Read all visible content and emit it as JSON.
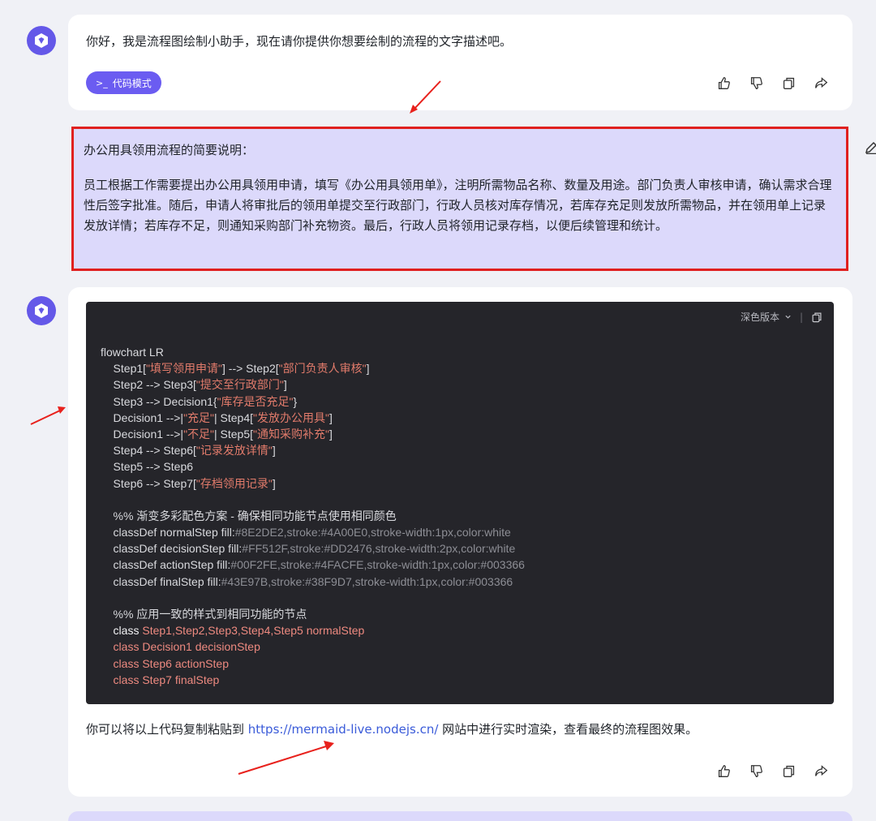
{
  "assistant_greeting": {
    "text": "你好，我是流程图绘制小助手，现在请你提供你想要绘制的流程的文字描述吧。",
    "mode_button_icon": ">_",
    "mode_button_label": "代码模式"
  },
  "user_message": {
    "title": "办公用具领用流程的简要说明：",
    "body": "员工根据工作需要提出办公用具领用申请，填写《办公用具领用单》，注明所需物品名称、数量及用途。部门负责人审核申请，确认需求合理性后签字批准。随后，申请人将审批后的领用单提交至行政部门，行政人员核对库存情况，若库存充足则发放所需物品，并在领用单上记录发放详情；若库存不足，则通知采购部门补充物资。最后，行政人员将领用记录存档，以便后续管理和统计。"
  },
  "code_block": {
    "theme_label": "深色版本",
    "lines": [
      [
        {
          "t": "flowchart LR",
          "c": ""
        }
      ],
      [
        {
          "t": "    Step1[",
          "c": ""
        },
        {
          "t": "\"填写领用申请\"",
          "c": "str"
        },
        {
          "t": "] --> Step2[",
          "c": ""
        },
        {
          "t": "\"部门负责人审核\"",
          "c": "str"
        },
        {
          "t": "]",
          "c": ""
        }
      ],
      [
        {
          "t": "    Step2 --> Step3[",
          "c": ""
        },
        {
          "t": "\"提交至行政部门\"",
          "c": "str"
        },
        {
          "t": "]",
          "c": ""
        }
      ],
      [
        {
          "t": "    Step3 --> Decision1{",
          "c": ""
        },
        {
          "t": "\"库存是否充足\"",
          "c": "str"
        },
        {
          "t": "}",
          "c": ""
        }
      ],
      [
        {
          "t": "    Decision1 -->|",
          "c": ""
        },
        {
          "t": "\"充足\"",
          "c": "str"
        },
        {
          "t": "| Step4[",
          "c": ""
        },
        {
          "t": "\"发放办公用具\"",
          "c": "str"
        },
        {
          "t": "]",
          "c": ""
        }
      ],
      [
        {
          "t": "    Decision1 -->|",
          "c": ""
        },
        {
          "t": "\"不足\"",
          "c": "str"
        },
        {
          "t": "| Step5[",
          "c": ""
        },
        {
          "t": "\"通知采购补充\"",
          "c": "str"
        },
        {
          "t": "]",
          "c": ""
        }
      ],
      [
        {
          "t": "    Step4 --> Step6[",
          "c": ""
        },
        {
          "t": "\"记录发放详情\"",
          "c": "str"
        },
        {
          "t": "]",
          "c": ""
        }
      ],
      [
        {
          "t": "    Step5 --> Step6",
          "c": ""
        }
      ],
      [
        {
          "t": "    Step6 --> Step7[",
          "c": ""
        },
        {
          "t": "\"存档领用记录\"",
          "c": "str"
        },
        {
          "t": "]",
          "c": ""
        }
      ],
      [
        {
          "t": "",
          "c": ""
        }
      ],
      [
        {
          "t": "    %% 渐变多彩配色方案 - 确保相同功能节点使用相同颜色",
          "c": ""
        }
      ],
      [
        {
          "t": "    classDef normalStep fill:",
          "c": ""
        },
        {
          "t": "#8E2DE2,stroke:#4A00E0,stroke-width:1px,color:white",
          "c": "dim"
        }
      ],
      [
        {
          "t": "    classDef decisionStep fill:",
          "c": ""
        },
        {
          "t": "#FF512F,stroke:#DD2476,stroke-width:2px,color:white",
          "c": "dim"
        }
      ],
      [
        {
          "t": "    classDef actionStep fill:",
          "c": ""
        },
        {
          "t": "#00F2FE,stroke:#4FACFE,stroke-width:1px,color:#003366",
          "c": "dim"
        }
      ],
      [
        {
          "t": "    classDef finalStep fill:",
          "c": ""
        },
        {
          "t": "#43E97B,stroke:#38F9D7,stroke-width:1px,color:#003366",
          "c": "dim"
        }
      ],
      [
        {
          "t": "",
          "c": ""
        }
      ],
      [
        {
          "t": "    %% 应用一致的样式到相同功能的节点",
          "c": ""
        }
      ],
      [
        {
          "t": "    class ",
          "c": "kw"
        },
        {
          "t": "Step1,Step2,Step3,Step4,Step5 normalStep",
          "c": "pink"
        }
      ],
      [
        {
          "t": "    class Decision1 decisionStep",
          "c": "pink"
        }
      ],
      [
        {
          "t": "    class Step6 actionStep",
          "c": "pink"
        }
      ],
      [
        {
          "t": "    class Step7 finalStep",
          "c": "pink"
        }
      ]
    ]
  },
  "after_text": {
    "before_link": "你可以将以上代码复制粘贴到 ",
    "link": "https://mermaid-live.nodejs.cn/",
    "after_link": " 网站中进行实时渲染，查看最终的流程图效果。"
  },
  "icons": {
    "avatar": "assistant-logo-icon",
    "like": "thumbs-up-icon",
    "dislike": "thumbs-down-icon",
    "copy": "copy-icon",
    "share": "share-icon",
    "edit": "edit-icon",
    "chevron": "chevron-down-icon"
  },
  "colors": {
    "accent": "#6b5cf1",
    "user_bubble": "#dcd9fb",
    "highlight_border": "#e0201f",
    "annotation_arrow": "#e8211c",
    "code_bg": "#25252a",
    "link": "#3a5bd9"
  }
}
